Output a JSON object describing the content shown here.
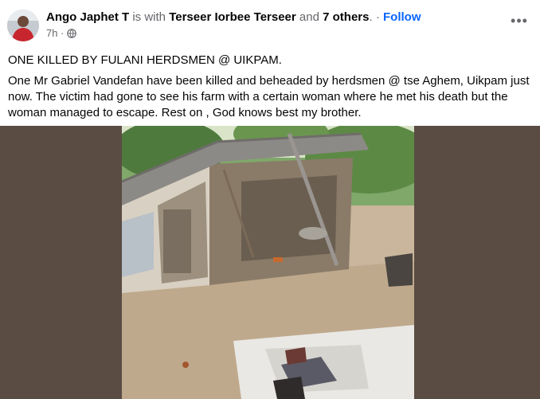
{
  "post": {
    "author": "Ango Japhet T",
    "with_text": "is with",
    "tagged": "Terseer Iorbee Terseer",
    "and_text": "and",
    "others": "7 others",
    "dot": ". ·",
    "follow": "Follow",
    "time": "7h ·",
    "privacy_icon": "globe-icon",
    "more_label": "•••",
    "title": "ONE KILLED BY FULANI HERDSMEN @ UIKPAM.",
    "body": "One Mr Gabriel Vandefan have been killed and beheaded by herdsmen @ tse Aghem, Uikpam just now. The victim had gone to see his farm with a certain woman where he met his death but the woman managed to escape. Rest on , God knows best my brother."
  },
  "colors": {
    "link": "#0866ff",
    "muted": "#65676b",
    "text": "#050505",
    "media_bg": "#5a4c43"
  }
}
